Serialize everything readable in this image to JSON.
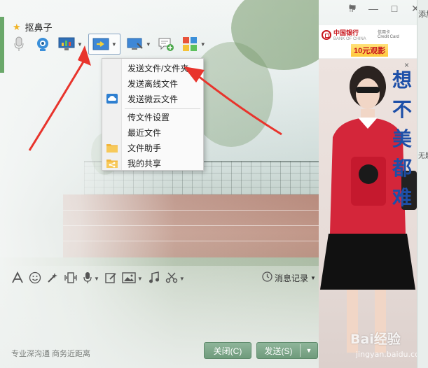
{
  "window": {
    "controls": {
      "flag": "⚑",
      "minimize": "—",
      "maximize": "□",
      "close": "✕"
    }
  },
  "contact": {
    "name": "抠鼻子"
  },
  "toolbar": {
    "items": [
      {
        "name": "microphone-icon"
      },
      {
        "name": "webcam-icon"
      },
      {
        "name": "screen-share-icon"
      },
      {
        "name": "send-file-icon"
      },
      {
        "name": "remote-desktop-icon"
      },
      {
        "name": "add-chat-icon"
      },
      {
        "name": "apps-grid-icon"
      }
    ]
  },
  "file_menu": {
    "items": [
      {
        "label": "发送文件/文件夹",
        "icon": ""
      },
      {
        "label": "发送离线文件",
        "icon": ""
      },
      {
        "label": "发送微云文件",
        "icon": "weiyun-cloud-icon"
      },
      {
        "label": "传文件设置",
        "icon": ""
      },
      {
        "label": "最近文件",
        "icon": ""
      },
      {
        "label": "文件助手",
        "icon": "folder-icon"
      },
      {
        "label": "我的共享",
        "icon": "share-icon"
      }
    ]
  },
  "input_toolbar": {
    "history_label": "消息记录"
  },
  "footer": {
    "slogan": "专业深沟通 商务近距离",
    "close_label": "关闭(C)",
    "send_label": "发送(S)"
  },
  "ad": {
    "bank": "中国银行",
    "bank_en": "BANK OF CHINA",
    "card": "信用卡",
    "card_en": "Credit Card",
    "promo": "10元观影",
    "slogan_chars": [
      "想",
      "不",
      "美",
      "都",
      "难"
    ],
    "close": "×"
  },
  "watermark": {
    "text": "Bai经验",
    "sub": "jingyan.baidu.com"
  },
  "right_edge": {
    "top": "添加",
    "mid": "无题"
  },
  "colors": {
    "accent_green": "#6f9b7c",
    "ad_blue": "#1d4fa8",
    "bank_red": "#c8161d",
    "arrow_red": "#e8342c"
  }
}
